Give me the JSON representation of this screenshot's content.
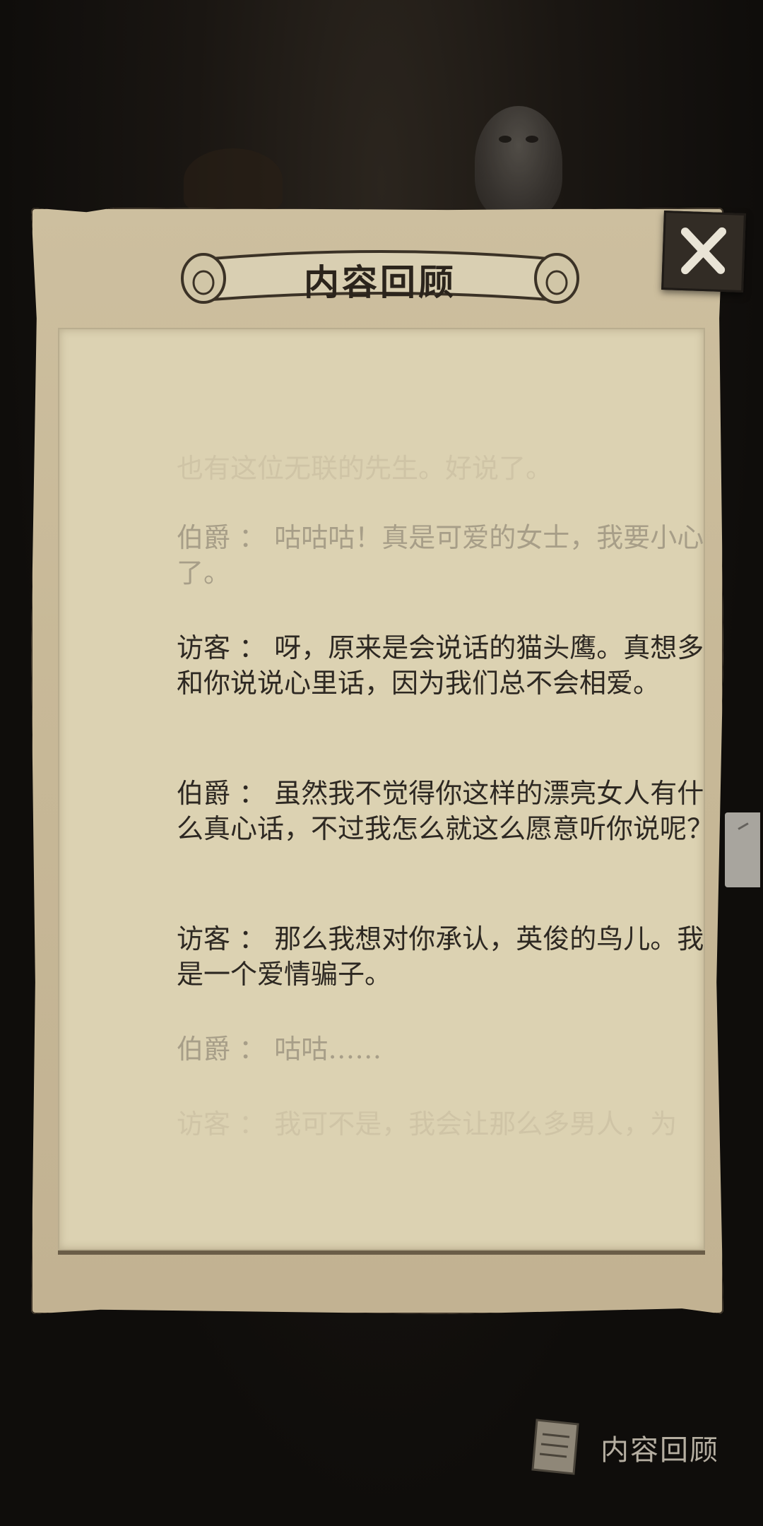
{
  "panel": {
    "title": "内容回顾",
    "close_icon": "close-icon"
  },
  "dialogue": [
    {
      "speaker": "",
      "sep": "",
      "text": "也有这位无联的先生。好说了。",
      "style": "faint"
    },
    {
      "speaker": "伯爵",
      "sep": " ： ",
      "text": "咕咕咕！真是可爱的女士，我要小心了。",
      "style": "dim"
    },
    {
      "speaker": "访客",
      "sep": " ： ",
      "text": "呀，原来是会说话的猫头鹰。真想多和你说说心里话，因为我们总不会相爱。",
      "style": "normal"
    },
    {
      "speaker": "伯爵",
      "sep": " ： ",
      "text": "虽然我不觉得你这样的漂亮女人有什么真心话，不过我怎么就这么愿意听你说呢？",
      "style": "normal"
    },
    {
      "speaker": "访客",
      "sep": " ： ",
      "text": "那么我想对你承认，英俊的鸟儿。我是一个爱情骗子。",
      "style": "normal"
    },
    {
      "speaker": "伯爵",
      "sep": " ： ",
      "text": "咕咕……",
      "style": "dim"
    },
    {
      "speaker": "访客",
      "sep": " ： ",
      "text": "我可不是，我会让那么多男人，为",
      "style": "faint"
    }
  ],
  "bottom_button": {
    "label": "内容回顾",
    "icon": "scroll-document-icon"
  },
  "colors": {
    "parchment": "#dcd2b2",
    "frame": "#c8b998",
    "text": "#2d2822"
  }
}
